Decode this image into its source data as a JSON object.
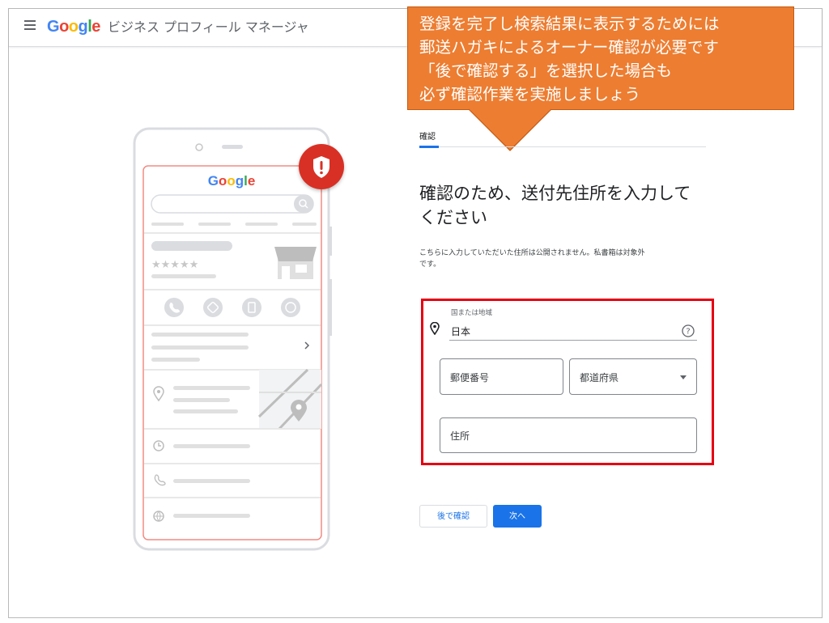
{
  "header": {
    "logo_text": "Google",
    "title": "ビジネス プロフィール マネージャ",
    "colors": {
      "blue": "#4285f4",
      "red": "#ea4335",
      "yellow": "#fbbc05",
      "green": "#34a853"
    }
  },
  "callout": {
    "lines": [
      "登録を完了し検索結果に表示するためには",
      "郵送ハガキによるオーナー確認が必要です",
      "「後で確認する」を選択した場合も",
      "必ず確認作業を実施しましょう"
    ],
    "color": "#ed7d31"
  },
  "phone": {
    "logo_text": "Google",
    "stars": "★★★★★",
    "shield_icon": "shield-alert-icon",
    "accent": "#d93025"
  },
  "form": {
    "tab_label": "確認",
    "heading_line1": "確認のため、送付先住所を入力して",
    "heading_line2": "ください",
    "note_line1": "こちらに入力していただいた住所は公開されません。私書箱は対象外",
    "note_line2": "です。",
    "country_label": "国または地域",
    "country_value": "日本",
    "postal_placeholder": "郵便番号",
    "prefecture_placeholder": "都道府県",
    "address_placeholder": "住所"
  },
  "buttons": {
    "later_label": "後で確認",
    "next_label": "次へ",
    "primary_color": "#1a73e8"
  },
  "highlight_color": "#e60012"
}
